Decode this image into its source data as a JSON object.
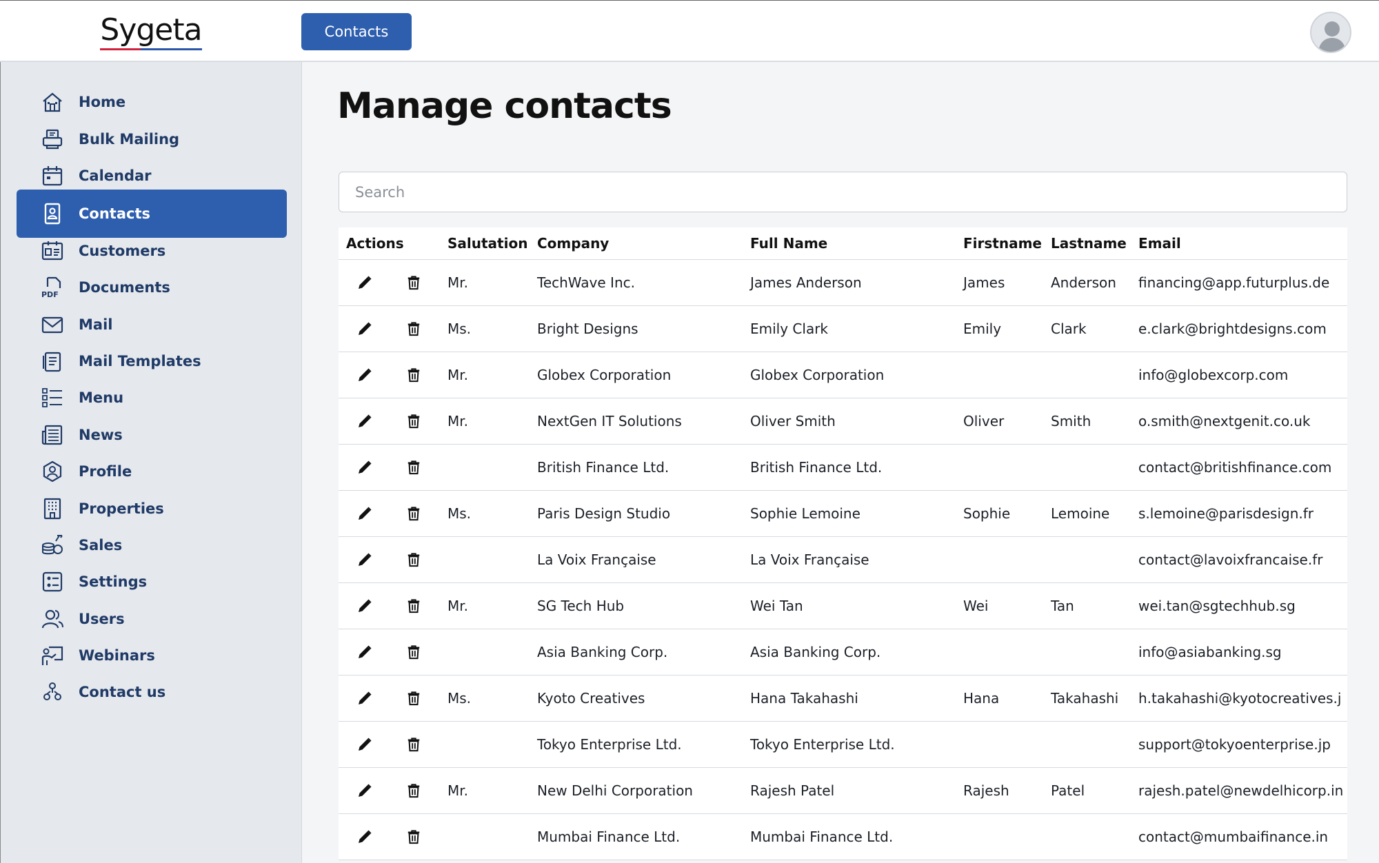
{
  "app": {
    "logo": "Sygeta",
    "top_button": "Contacts"
  },
  "colors": {
    "accent": "#2e5fae",
    "sidebar_bg": "#e5e8ed",
    "nav_text": "#1f3a66"
  },
  "sidebar": {
    "items": [
      {
        "label": "Home",
        "icon": "home-icon",
        "active": false
      },
      {
        "label": "Bulk Mailing",
        "icon": "printer-icon",
        "active": false
      },
      {
        "label": "Calendar",
        "icon": "calendar-icon",
        "active": false
      },
      {
        "label": "Contacts",
        "icon": "contact-card-icon",
        "active": true
      },
      {
        "label": "Customers",
        "icon": "customers-icon",
        "active": false
      },
      {
        "label": "Documents",
        "icon": "pdf-icon",
        "active": false
      },
      {
        "label": "Mail",
        "icon": "mail-icon",
        "active": false
      },
      {
        "label": "Mail Templates",
        "icon": "template-icon",
        "active": false
      },
      {
        "label": "Menu",
        "icon": "menu-list-icon",
        "active": false
      },
      {
        "label": "News",
        "icon": "news-icon",
        "active": false
      },
      {
        "label": "Profile",
        "icon": "profile-icon",
        "active": false
      },
      {
        "label": "Properties",
        "icon": "building-icon",
        "active": false
      },
      {
        "label": "Sales",
        "icon": "sales-icon",
        "active": false
      },
      {
        "label": "Settings",
        "icon": "settings-icon",
        "active": false
      },
      {
        "label": "Users",
        "icon": "users-icon",
        "active": false
      },
      {
        "label": "Webinars",
        "icon": "webinar-icon",
        "active": false
      },
      {
        "label": "Contact us",
        "icon": "contact-us-icon",
        "active": false
      }
    ]
  },
  "main": {
    "title": "Manage contacts",
    "search_placeholder": "Search",
    "columns": [
      "Actions",
      "Salutation",
      "Company",
      "Full Name",
      "Firstname",
      "Lastname",
      "Email"
    ],
    "rows": [
      {
        "salutation": "Mr.",
        "company": "TechWave Inc.",
        "full_name": "James Anderson",
        "firstname": "James",
        "lastname": "Anderson",
        "email": "financing@app.futurplus.de"
      },
      {
        "salutation": "Ms.",
        "company": "Bright Designs",
        "full_name": "Emily Clark",
        "firstname": "Emily",
        "lastname": "Clark",
        "email": "e.clark@brightdesigns.com"
      },
      {
        "salutation": "Mr.",
        "company": "Globex Corporation",
        "full_name": "Globex Corporation",
        "firstname": "",
        "lastname": "",
        "email": "info@globexcorp.com"
      },
      {
        "salutation": "Mr.",
        "company": "NextGen IT Solutions",
        "full_name": "Oliver Smith",
        "firstname": "Oliver",
        "lastname": "Smith",
        "email": "o.smith@nextgenit.co.uk"
      },
      {
        "salutation": "",
        "company": "British Finance Ltd.",
        "full_name": "British Finance Ltd.",
        "firstname": "",
        "lastname": "",
        "email": "contact@britishfinance.com"
      },
      {
        "salutation": "Ms.",
        "company": "Paris Design Studio",
        "full_name": "Sophie Lemoine",
        "firstname": "Sophie",
        "lastname": "Lemoine",
        "email": "s.lemoine@parisdesign.fr"
      },
      {
        "salutation": "",
        "company": "La Voix Française",
        "full_name": "La Voix Française",
        "firstname": "",
        "lastname": "",
        "email": "contact@lavoixfrancaise.fr"
      },
      {
        "salutation": "Mr.",
        "company": "SG Tech Hub",
        "full_name": "Wei Tan",
        "firstname": "Wei",
        "lastname": "Tan",
        "email": "wei.tan@sgtechhub.sg"
      },
      {
        "salutation": "",
        "company": "Asia Banking Corp.",
        "full_name": "Asia Banking Corp.",
        "firstname": "",
        "lastname": "",
        "email": "info@asiabanking.sg"
      },
      {
        "salutation": "Ms.",
        "company": "Kyoto Creatives",
        "full_name": "Hana Takahashi",
        "firstname": "Hana",
        "lastname": "Takahashi",
        "email": "h.takahashi@kyotocreatives.j"
      },
      {
        "salutation": "",
        "company": "Tokyo Enterprise Ltd.",
        "full_name": "Tokyo Enterprise Ltd.",
        "firstname": "",
        "lastname": "",
        "email": "support@tokyoenterprise.jp"
      },
      {
        "salutation": "Mr.",
        "company": "New Delhi Corporation",
        "full_name": "Rajesh Patel",
        "firstname": "Rajesh",
        "lastname": "Patel",
        "email": "rajesh.patel@newdelhicorp.in"
      },
      {
        "salutation": "",
        "company": "Mumbai Finance Ltd.",
        "full_name": "Mumbai Finance Ltd.",
        "firstname": "",
        "lastname": "",
        "email": "contact@mumbaifinance.in"
      }
    ]
  }
}
